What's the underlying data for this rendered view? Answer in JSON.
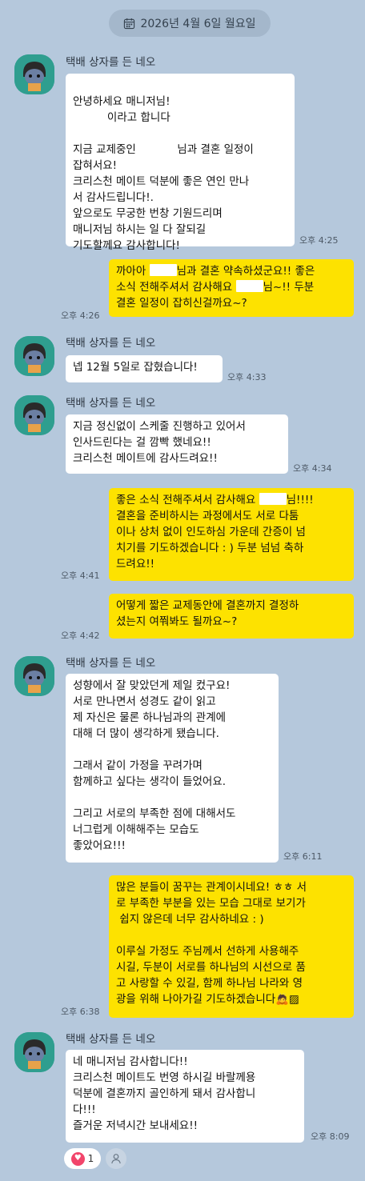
{
  "date_divider": "2026년 4월 6일 월요일",
  "sender_name": "택배 상자를 든 네오",
  "messages": [
    {
      "lines": [
        "안녕하세요 매니저님!",
        "          이라고 합니다",
        "",
        "지금 교제중인            님과 결혼 일정이",
        "잡혀서요!",
        "크리스천 메이트 덕분에 좋은 연인 만나",
        "서 감사드립니다!.",
        "앞으로도 무궁한 번창 기원드리며",
        "매니저님 하시는 일 다 잘되길",
        "기도할께요 감사합니다!"
      ],
      "time": "오후 4:25"
    },
    {
      "pre": "까아아",
      "mid": "님과 결혼 약속하셨군요!! 좋은",
      "line2_pre": "소식 전해주셔서 감사해요",
      "line2_post": "님~!! 두분",
      "line3": "결혼 일정이 잡히신걸까요~?",
      "time": "오후 4:26"
    },
    {
      "text": "넵 12월 5일로 잡혔습니다!",
      "time": "오후 4:33"
    },
    {
      "text": "지금 정신없이 스케줄 진행하고 있어서\n인사드린다는 걸 깜빡 했네요!!\n크리스천 메이트에 감사드려요!!",
      "time": "오후 4:34"
    },
    {
      "line1_pre": "좋은 소식 전해주셔서 감사해요",
      "line1_post": "님!!!!",
      "rest": "결혼을 준비하시는 과정에서도 서로 다툼\n이나 상처 없이 인도하심 가운데 간증이 넘\n치기를 기도하겠습니다 : ) 두분 넘넘 축하\n드려요!!",
      "time": "오후 4:41"
    },
    {
      "text": "어떻게 짧은 교제동안에 결혼까지 결정하\n셨는지 여쭤봐도 될까요~?",
      "time": "오후 4:42"
    },
    {
      "text": "성향에서 잘 맞았던게 제일 컸구요!\n서로 만나면서 성경도 같이 읽고\n제 자신은 물론 하나님과의 관계에\n대해 더 많이 생각하게 됐습니다.\n\n그래서 같이 가정을 꾸려가며\n함께하고 싶다는 생각이 들었어요.\n\n그리고 서로의 부족한 점에 대해서도\n너그럽게 이해해주는 모습도\n좋았어요!!!",
      "time": "오후 6:11"
    },
    {
      "text": "많은 분들이 꿈꾸는 관계이시네요! ㅎㅎ 서\n로 부족한 부분을 있는 모습 그대로 보기가\n 쉽지 않은데 너무 감사하네요 : )\n\n이루실 가정도 주님께서 선하게 사용해주\n시길, 두분이 서로를 하나님의 시선으로 품\n고 사랑할 수 있길, 함께 하나님 나라와 영\n광을 위해 나아가길 기도하겠습니다",
      "emoji_1": "🙇",
      "emoji_2": "▨",
      "time": "오후 6:38"
    },
    {
      "text": "네 매니저님 감사합니다!!\n크리스천 메이트도 번영 하시길 바랄께용\n덕분에 결혼까지 골인하게 돼서 감사합니\n다!!!\n즐거운 저녁시간 보내세요!!",
      "time": "오후 8:09"
    }
  ],
  "reaction": {
    "icon": "heart-icon",
    "count": "1"
  },
  "colors": {
    "background": "#b5c8dc",
    "outgoing": "#fde200",
    "incoming": "#ffffff",
    "avatar": "#2f9e8f"
  }
}
